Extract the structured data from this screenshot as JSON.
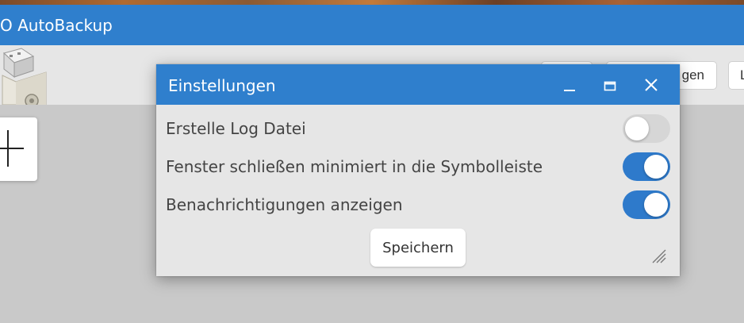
{
  "app": {
    "title": "O AutoBackup",
    "bg_buttons": [
      "",
      "gen",
      "L"
    ]
  },
  "dialog": {
    "title": "Einstellungen",
    "settings": [
      {
        "label": "Erstelle Log Datei",
        "enabled": false
      },
      {
        "label": "Fenster schließen minimiert in die Symbolleiste",
        "enabled": true
      },
      {
        "label": "Benachrichtigungen anzeigen",
        "enabled": true
      }
    ],
    "save_label": "Speichern"
  },
  "colors": {
    "accent": "#2f7fcd",
    "toggle_on": "#2e7acb",
    "toggle_off": "#d6d6d6",
    "background": "#c9c9c9",
    "panel": "#e6e6e6"
  },
  "icons": [
    "usb-drive-icon",
    "plus-icon",
    "minimize-icon",
    "maximize-icon",
    "close-icon",
    "resize-grip-icon"
  ]
}
